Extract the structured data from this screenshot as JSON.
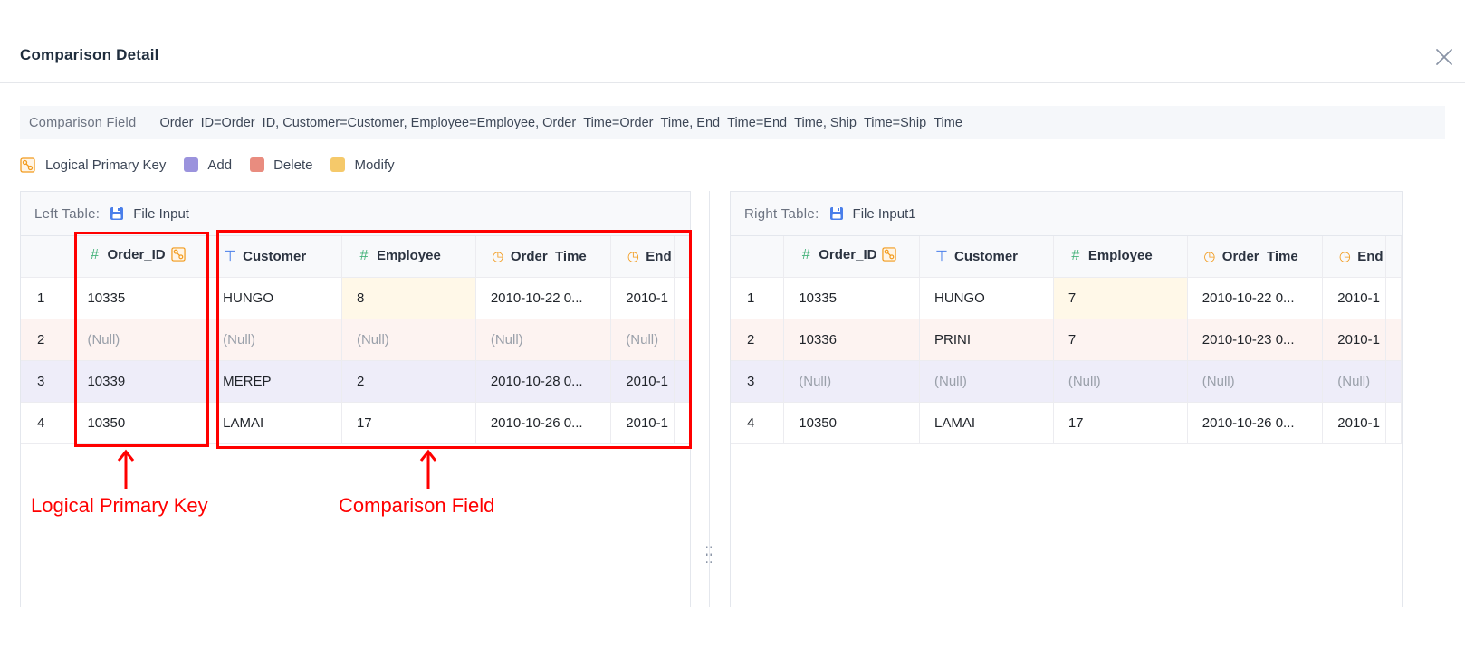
{
  "dialog": {
    "title": "Comparison Detail"
  },
  "comparison": {
    "label": "Comparison Field",
    "value": "Order_ID=Order_ID,  Customer=Customer,  Employee=Employee,  Order_Time=Order_Time,  End_Time=End_Time,  Ship_Time=Ship_Time"
  },
  "legend": {
    "primary_key": "Logical Primary Key",
    "add": "Add",
    "delete": "Delete",
    "modify": "Modify",
    "colors": {
      "add": "#9b93dd",
      "delete": "#e98c7f",
      "modify": "#f5c96a"
    }
  },
  "left_table": {
    "label": "Left Table:",
    "source": "File Input",
    "columns": [
      {
        "name": "Order_ID",
        "icon": "number-icon",
        "pk": true
      },
      {
        "name": "Customer",
        "icon": "text-icon"
      },
      {
        "name": "Employee",
        "icon": "number-icon"
      },
      {
        "name": "Order_Time",
        "icon": "clock-icon"
      },
      {
        "name": "End",
        "icon": "clock-icon"
      }
    ],
    "rows": [
      {
        "index": "1",
        "state": "modify",
        "cells": [
          "10335",
          "HUNGO",
          "8",
          "2010-10-22 0...",
          "2010-1"
        ]
      },
      {
        "index": "2",
        "state": "delete",
        "cells": [
          "(Null)",
          "(Null)",
          "(Null)",
          "(Null)",
          "(Null)"
        ]
      },
      {
        "index": "3",
        "state": "add",
        "cells": [
          "10339",
          "MEREP",
          "2",
          "2010-10-28 0...",
          "2010-1"
        ]
      },
      {
        "index": "4",
        "state": "none",
        "cells": [
          "10350",
          "LAMAI",
          "17",
          "2010-10-26 0...",
          "2010-1"
        ]
      }
    ]
  },
  "right_table": {
    "label": "Right Table:",
    "source": "File Input1",
    "columns": [
      {
        "name": "Order_ID",
        "icon": "number-icon",
        "pk": true
      },
      {
        "name": "Customer",
        "icon": "text-icon"
      },
      {
        "name": "Employee",
        "icon": "number-icon"
      },
      {
        "name": "Order_Time",
        "icon": "clock-icon"
      },
      {
        "name": "End",
        "icon": "clock-icon"
      }
    ],
    "rows": [
      {
        "index": "1",
        "state": "modify",
        "cells": [
          "10335",
          "HUNGO",
          "7",
          "2010-10-22 0...",
          "2010-1"
        ]
      },
      {
        "index": "2",
        "state": "delete",
        "cells": [
          "10336",
          "PRINI",
          "7",
          "2010-10-23 0...",
          "2010-1"
        ]
      },
      {
        "index": "3",
        "state": "add",
        "cells": [
          "(Null)",
          "(Null)",
          "(Null)",
          "(Null)",
          "(Null)"
        ]
      },
      {
        "index": "4",
        "state": "none",
        "cells": [
          "10350",
          "LAMAI",
          "17",
          "2010-10-26 0...",
          "2010-1"
        ]
      }
    ]
  },
  "annotations": {
    "primary_key": "Logical Primary Key",
    "comparison_field": "Comparison Field"
  }
}
